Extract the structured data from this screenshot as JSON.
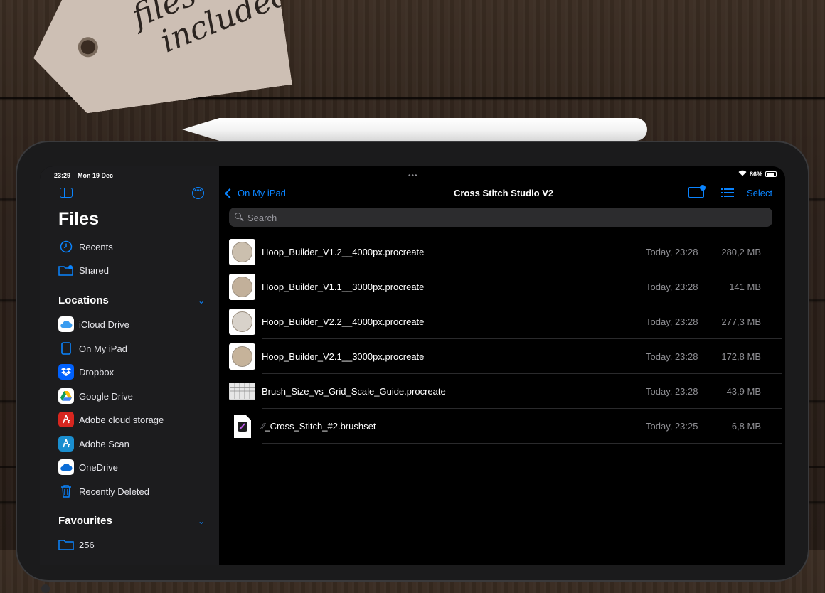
{
  "photo": {
    "tag_text_line1": "files",
    "tag_text_line2": "included"
  },
  "status_bar": {
    "time": "23:29",
    "date": "Mon 19 Dec",
    "battery": "86%",
    "battery_level": 0.86
  },
  "sidebar": {
    "title": "Files",
    "top_items": [
      {
        "label": "Recents",
        "icon": "clock-icon"
      },
      {
        "label": "Shared",
        "icon": "shared-folder-icon"
      }
    ],
    "locations": {
      "title": "Locations",
      "items": [
        {
          "label": "iCloud Drive",
          "icon": "icloud-icon",
          "color": "#ffffff"
        },
        {
          "label": "On My iPad",
          "icon": "ipad-icon",
          "color": "#0a84ff"
        },
        {
          "label": "Dropbox",
          "icon": "dropbox-icon",
          "color": "#0061fe"
        },
        {
          "label": "Google Drive",
          "icon": "google-drive-icon",
          "color": "#ffffff"
        },
        {
          "label": "Adobe cloud storage",
          "icon": "adobe-acrobat-icon",
          "color": "#d7261f"
        },
        {
          "label": "Adobe Scan",
          "icon": "adobe-scan-icon",
          "color": "#1a8ecf"
        },
        {
          "label": "OneDrive",
          "icon": "onedrive-icon",
          "color": "#ffffff"
        },
        {
          "label": "Recently Deleted",
          "icon": "trash-icon",
          "color": "#0a84ff"
        }
      ]
    },
    "favourites": {
      "title": "Favourites",
      "items": [
        {
          "label": "256",
          "icon": "folder-icon"
        }
      ]
    }
  },
  "toolbar": {
    "back_label": "On My iPad",
    "title": "Cross Stitch Studio V2",
    "select_label": "Select"
  },
  "search": {
    "placeholder": "Search"
  },
  "files": [
    {
      "name": "Hoop_Builder_V1.2__4000px.procreate",
      "date": "Today, 23:28",
      "size": "280,2 MB",
      "thumb": "hoop"
    },
    {
      "name": "Hoop_Builder_V1.1__3000px.procreate",
      "date": "Today, 23:28",
      "size": "141 MB",
      "thumb": "hoop"
    },
    {
      "name": "Hoop_Builder_V2.2__4000px.procreate",
      "date": "Today, 23:28",
      "size": "277,3 MB",
      "thumb": "hoop"
    },
    {
      "name": "Hoop_Builder_V2.1__3000px.procreate",
      "date": "Today, 23:28",
      "size": "172,8 MB",
      "thumb": "hoop"
    },
    {
      "name": "Brush_Size_vs_Grid_Scale_Guide.procreate",
      "date": "Today, 23:28",
      "size": "43,9 MB",
      "thumb": "grid"
    },
    {
      "name": "_Cross_Stitch_#2.brushset",
      "date": "Today, 23:25",
      "size": "6,8 MB",
      "thumb": "brushset"
    }
  ]
}
